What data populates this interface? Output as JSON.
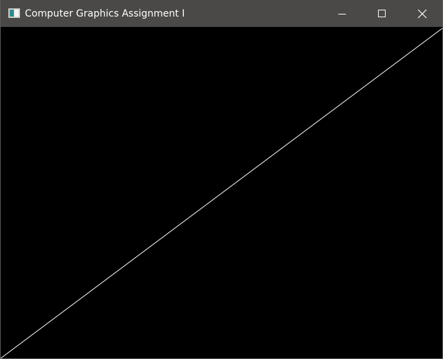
{
  "window": {
    "title": "Computer Graphics Assignment I",
    "controls": {
      "minimize": "minimize",
      "maximize": "maximize",
      "close": "close"
    }
  },
  "canvas": {
    "background_color": "#000000",
    "line_color": "#ffffff",
    "content": "single diagonal line from bottom-left corner to top-right corner"
  },
  "colors": {
    "titlebar": "#4a4948",
    "title_text": "#ffffff"
  }
}
